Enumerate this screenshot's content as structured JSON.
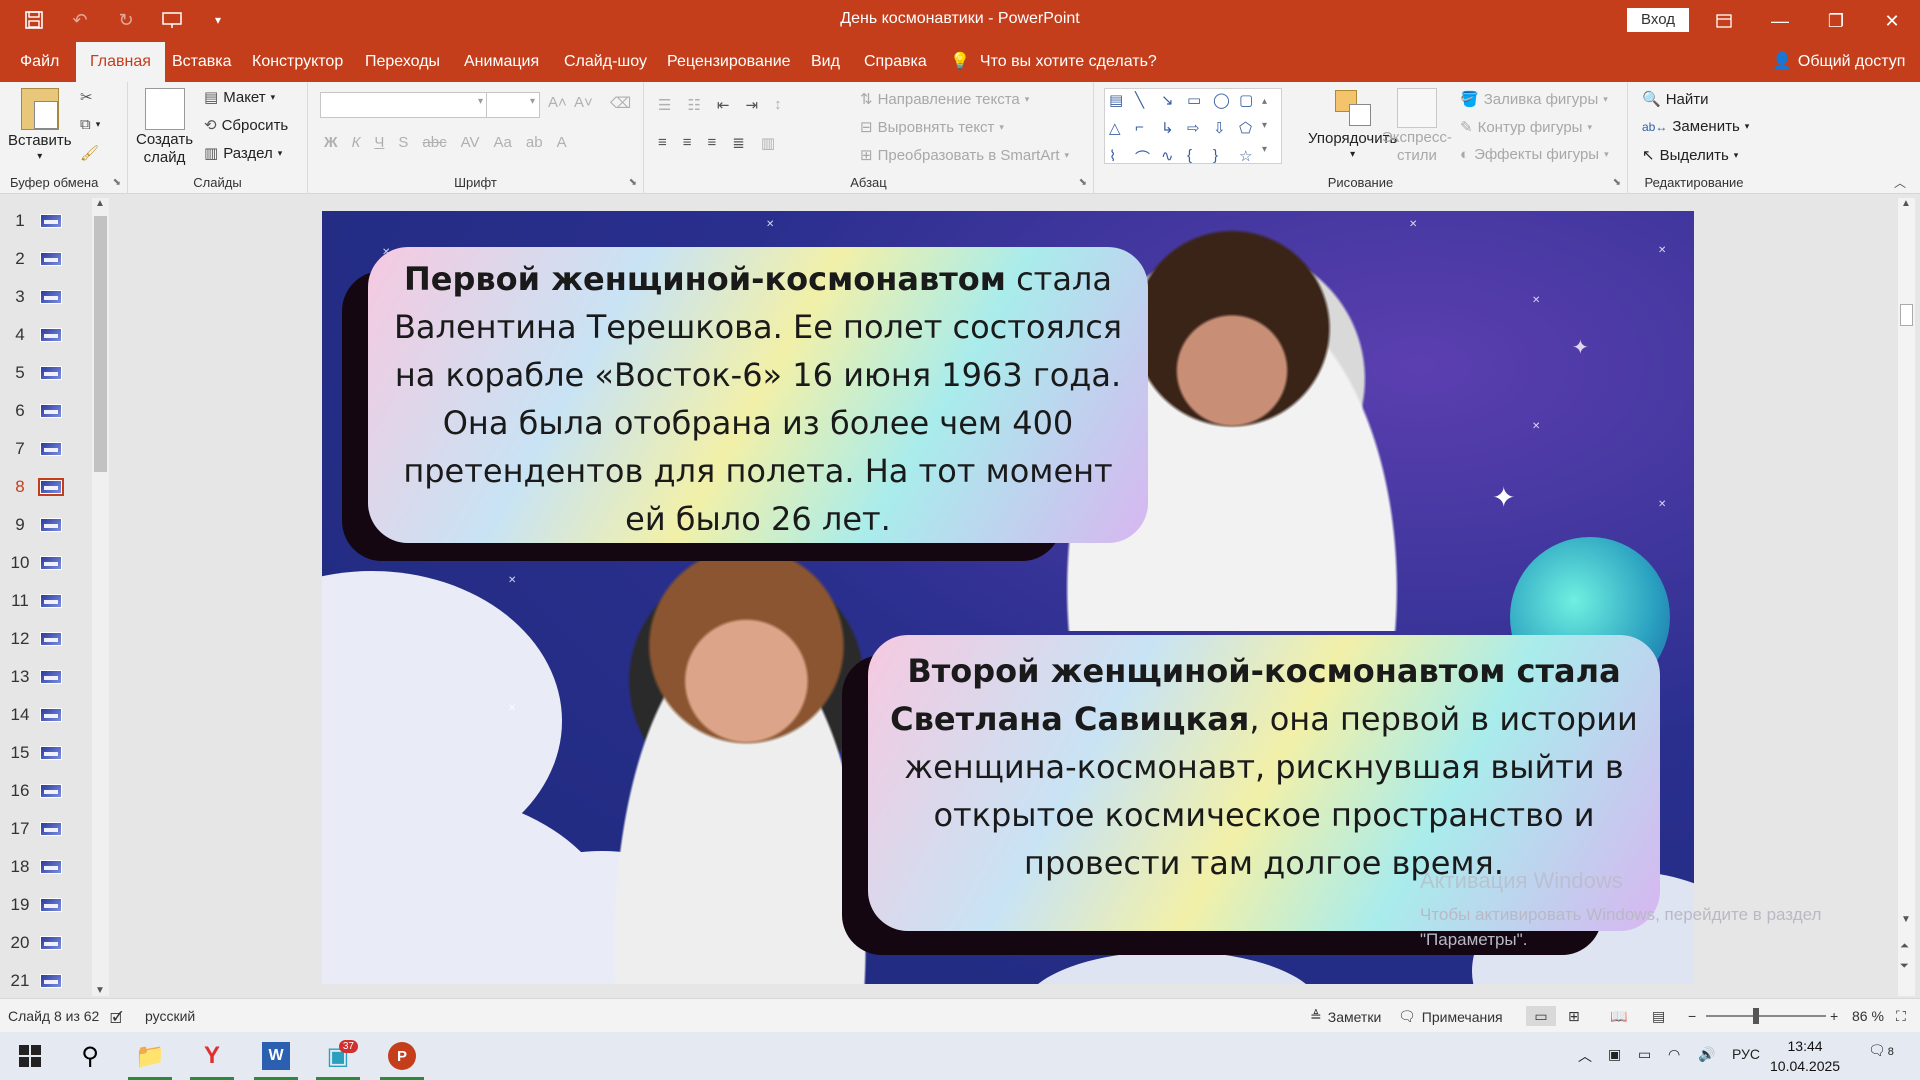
{
  "window": {
    "title": "День космонавтики - PowerPoint",
    "signin_label": "Вход"
  },
  "tabs": [
    "Файл",
    "Главная",
    "Вставка",
    "Конструктор",
    "Переходы",
    "Анимация",
    "Слайд-шоу",
    "Рецензирование",
    "Вид",
    "Справка"
  ],
  "tell_me": "Что вы хотите сделать?",
  "share_label": "Общий доступ",
  "ribbon": {
    "clipboard": {
      "label": "Буфер обмена",
      "paste": "Вставить"
    },
    "slides": {
      "label": "Слайды",
      "new_slide_line1": "Создать",
      "new_slide_line2": "слайд",
      "layout": "Макет",
      "reset": "Сбросить",
      "section": "Раздел"
    },
    "font": {
      "label": "Шрифт"
    },
    "paragraph": {
      "label": "Абзац",
      "text_direction": "Направление текста",
      "align_text": "Выровнять текст",
      "smartart": "Преобразовать в SmartArt"
    },
    "drawing": {
      "label": "Рисование",
      "arrange": "Упорядочить",
      "quick_styles_line1": "Экспресс-",
      "quick_styles_line2": "стили",
      "shape_fill": "Заливка фигуры",
      "shape_outline": "Контур фигуры",
      "shape_effects": "Эффекты фигуры"
    },
    "editing": {
      "label": "Редактирование",
      "find": "Найти",
      "replace": "Заменить",
      "select": "Выделить"
    }
  },
  "thumbnails": [
    "1",
    "2",
    "3",
    "4",
    "5",
    "6",
    "7",
    "8",
    "9",
    "10",
    "11",
    "12",
    "13",
    "14",
    "15",
    "16",
    "17",
    "18",
    "19",
    "20",
    "21"
  ],
  "selected_slide": "8",
  "slide": {
    "box1_bold": "Первой женщиной-космонавтом",
    "box1_text": " стала Валентина Терешкова. Ее полет состоялся на корабле «Восток-6» 16 июня 1963 года. Она была отобрана из более чем 400 претендентов для полета. На тот момент ей было 26 лет.",
    "box2_bold": "Второй женщиной-космонавтом стала Светлана Савицкая",
    "box2_text": ", она первой в истории женщина-космонавт, рискнувшая выйти в открытое космическое пространство и провести там долгое время."
  },
  "activation": {
    "title": "Активация Windows",
    "line1": "Чтобы активировать Windows, перейдите в раздел",
    "line2": "\"Параметры\"."
  },
  "status": {
    "slide_info": "Слайд 8 из 62",
    "language": "русский",
    "notes": "Заметки",
    "comments": "Примечания",
    "zoom": "86 %"
  },
  "taskbar": {
    "badge": "37",
    "lang": "РУС",
    "time": "13:44",
    "date": "10.04.2025",
    "notif_count": "8"
  },
  "colors": {
    "accent": "#c43e1c"
  }
}
